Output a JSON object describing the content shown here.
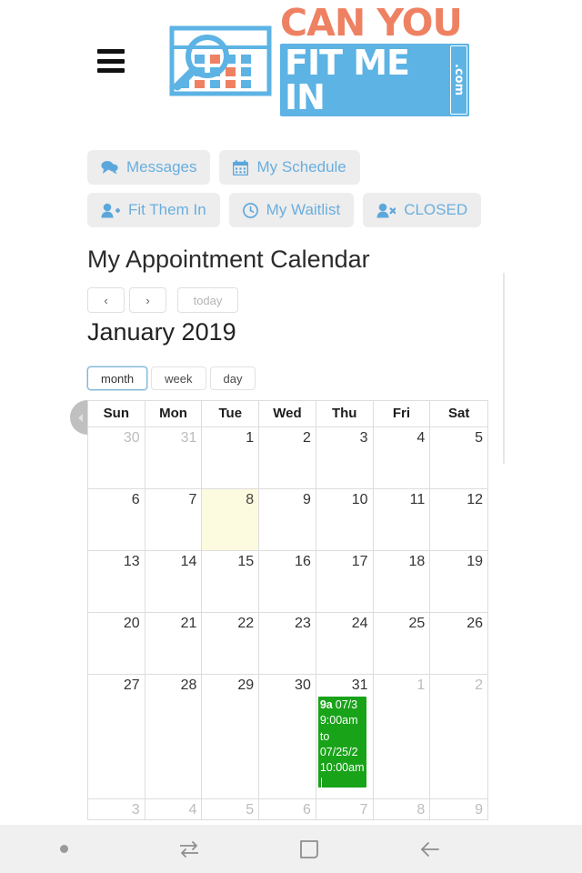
{
  "header": {
    "menu_icon": "hamburger-menu-icon",
    "logo": {
      "line1": "CAN YOU",
      "line2": "FIT ME IN",
      "suffix": ".com",
      "mark_icon": "calendar-magnifier-icon",
      "orange": "#ef8163",
      "blue": "#5cb3e4"
    }
  },
  "nav_buttons": [
    {
      "label": "Messages",
      "icon": "comments-icon"
    },
    {
      "label": "My Schedule",
      "icon": "calendar-icon"
    },
    {
      "label": "Fit Them In",
      "icon": "user-plus-icon"
    },
    {
      "label": "My Waitlist",
      "icon": "clock-icon"
    },
    {
      "label": "CLOSED",
      "icon": "user-times-icon"
    }
  ],
  "page": {
    "title": "My Appointment Calendar"
  },
  "calendar": {
    "toolbar": {
      "prev_label": "‹",
      "next_label": "›",
      "today_label": "today",
      "today_disabled": true
    },
    "month_title": "January 2019",
    "views": [
      {
        "label": "month",
        "active": true
      },
      {
        "label": "week",
        "active": false
      },
      {
        "label": "day",
        "active": false
      }
    ],
    "weekday_headers": [
      "Sun",
      "Mon",
      "Tue",
      "Wed",
      "Thu",
      "Fri",
      "Sat"
    ],
    "today_highlight_color": "#fcfadf",
    "event_color": "#19a319",
    "weeks": [
      [
        {
          "day": "30",
          "other": true
        },
        {
          "day": "31",
          "other": true
        },
        {
          "day": "1",
          "other": false
        },
        {
          "day": "2",
          "other": false
        },
        {
          "day": "3",
          "other": false
        },
        {
          "day": "4",
          "other": false
        },
        {
          "day": "5",
          "other": false
        }
      ],
      [
        {
          "day": "6",
          "other": false
        },
        {
          "day": "7",
          "other": false
        },
        {
          "day": "8",
          "other": false,
          "today": true
        },
        {
          "day": "9",
          "other": false
        },
        {
          "day": "10",
          "other": false
        },
        {
          "day": "11",
          "other": false
        },
        {
          "day": "12",
          "other": false
        }
      ],
      [
        {
          "day": "13",
          "other": false
        },
        {
          "day": "14",
          "other": false
        },
        {
          "day": "15",
          "other": false
        },
        {
          "day": "16",
          "other": false
        },
        {
          "day": "17",
          "other": false
        },
        {
          "day": "18",
          "other": false
        },
        {
          "day": "19",
          "other": false
        }
      ],
      [
        {
          "day": "20",
          "other": false
        },
        {
          "day": "21",
          "other": false
        },
        {
          "day": "22",
          "other": false
        },
        {
          "day": "23",
          "other": false
        },
        {
          "day": "24",
          "other": false
        },
        {
          "day": "25",
          "other": false
        },
        {
          "day": "26",
          "other": false
        }
      ],
      [
        {
          "day": "27",
          "other": false
        },
        {
          "day": "28",
          "other": false
        },
        {
          "day": "29",
          "other": false
        },
        {
          "day": "30",
          "other": false
        },
        {
          "day": "31",
          "other": false,
          "event": {
            "time": "9a",
            "lines": [
              "07/3",
              "9:00am",
              "to",
              "07/25/2",
              "10:00am",
              "|"
            ]
          }
        },
        {
          "day": "1",
          "other": true
        },
        {
          "day": "2",
          "other": true
        }
      ],
      [
        {
          "day": "3",
          "other": true
        },
        {
          "day": "4",
          "other": true
        },
        {
          "day": "5",
          "other": true
        },
        {
          "day": "6",
          "other": true
        },
        {
          "day": "7",
          "other": true
        },
        {
          "day": "8",
          "other": true
        },
        {
          "day": "9",
          "other": true
        }
      ]
    ]
  },
  "android_nav": {
    "items": [
      {
        "icon": "dot-indicator-icon"
      },
      {
        "icon": "switch-apps-icon"
      },
      {
        "icon": "home-square-icon"
      },
      {
        "icon": "back-arrow-icon"
      }
    ]
  }
}
